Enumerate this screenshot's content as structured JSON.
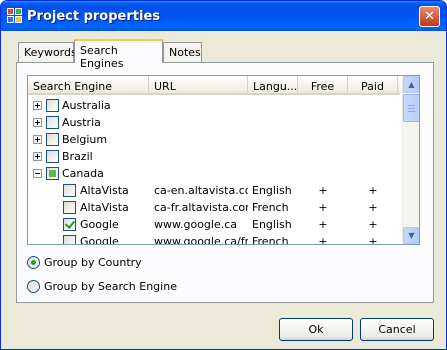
{
  "window": {
    "title": "Project properties",
    "close_glyph": "✕"
  },
  "tabs": [
    {
      "label": "Keywords",
      "active": false
    },
    {
      "label": "Search Engines",
      "active": true
    },
    {
      "label": "Notes",
      "active": false
    }
  ],
  "list": {
    "columns": [
      "Search Engine",
      "URL",
      "Langu...",
      "Free",
      "Paid"
    ],
    "rows": [
      {
        "level": 0,
        "expander": "plus",
        "check": "none",
        "name": "Australia"
      },
      {
        "level": 0,
        "expander": "plus",
        "check": "none",
        "name": "Austria"
      },
      {
        "level": 0,
        "expander": "plus",
        "check": "none",
        "name": "Belgium"
      },
      {
        "level": 0,
        "expander": "plus",
        "check": "none",
        "name": "Brazil"
      },
      {
        "level": 0,
        "expander": "minus",
        "check": "partial",
        "name": "Canada"
      },
      {
        "level": 1,
        "check": "none",
        "name": "AltaVista",
        "url": "ca-en.altavista.com",
        "lang": "English",
        "free": "+",
        "paid": "+"
      },
      {
        "level": 1,
        "check": "none",
        "name": "AltaVista",
        "url": "ca-fr.altavista.com",
        "lang": "French",
        "free": "+",
        "paid": "+"
      },
      {
        "level": 1,
        "check": "checked",
        "name": "Google",
        "url": "www.google.ca",
        "lang": "English",
        "free": "+",
        "paid": "+"
      },
      {
        "level": 1,
        "check": "none",
        "name": "Google",
        "url": "www.google.ca/fr",
        "lang": "French",
        "free": "+",
        "paid": "+"
      }
    ],
    "scroll_up_glyph": "▲",
    "scroll_down_glyph": "▼"
  },
  "grouping": {
    "options": [
      {
        "label": "Group by Country",
        "selected": true
      },
      {
        "label": "Group by Search Engine",
        "selected": false
      }
    ]
  },
  "buttons": {
    "ok": "Ok",
    "cancel": "Cancel"
  },
  "colors": {
    "titlebar": "#0054e3",
    "face": "#ece9d8",
    "tab_highlight": "#ffc83c",
    "check_green": "#21a121"
  }
}
